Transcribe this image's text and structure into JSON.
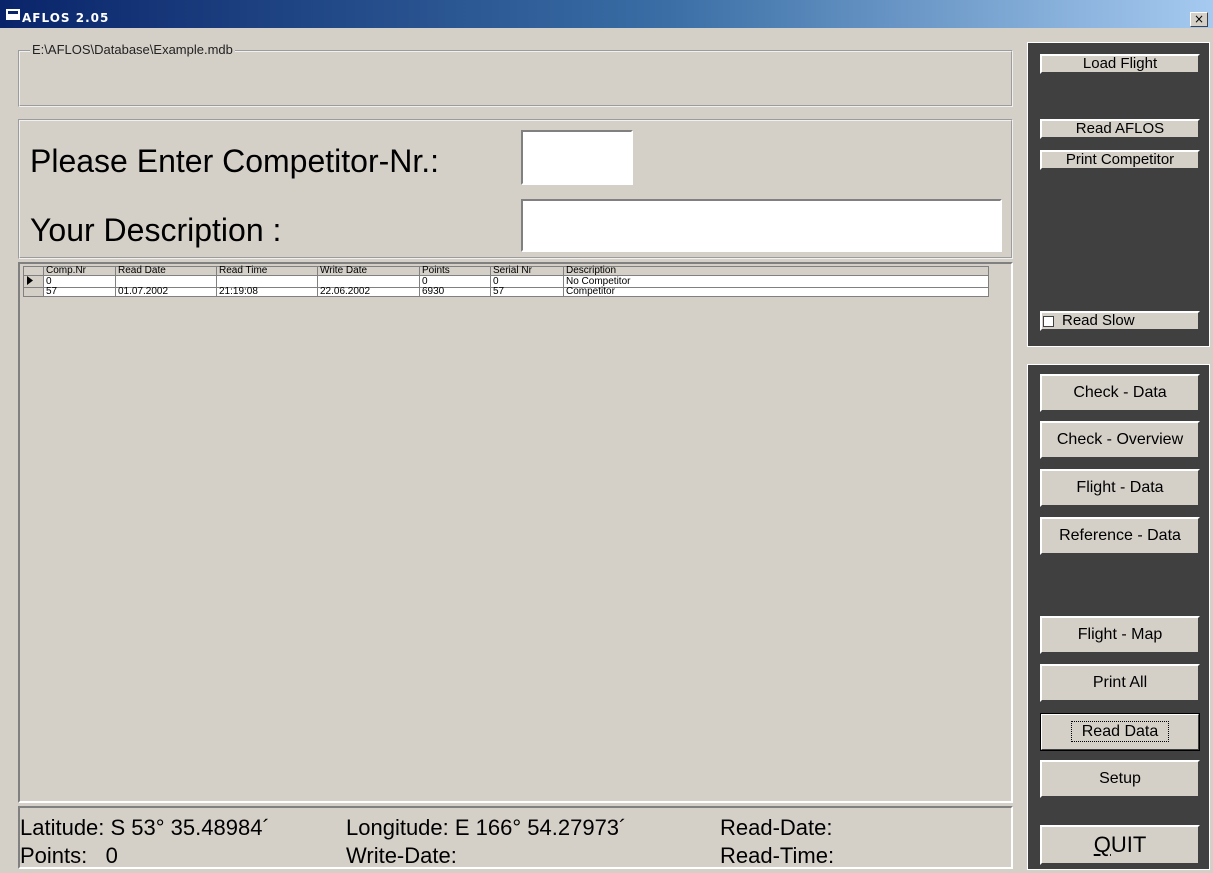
{
  "window": {
    "title": "AFLOS 2.05",
    "close_label": "×"
  },
  "database_path": "E:\\AFLOS\\Database\\Example.mdb",
  "entry": {
    "competitor_label": "Please Enter Competitor-Nr.:",
    "competitor_value": "",
    "description_label": "Your Description :",
    "description_value": ""
  },
  "grid": {
    "columns": [
      "Comp.Nr",
      "Read Date",
      "Read Time",
      "Write Date",
      "Points",
      "Serial Nr",
      "Description"
    ],
    "rows": [
      {
        "current": true,
        "cells": [
          "0",
          "",
          "",
          "",
          "0",
          "0",
          "No Competitor"
        ]
      },
      {
        "current": false,
        "cells": [
          "57",
          "01.07.2002",
          "21:19:08",
          "22.06.2002",
          "6930",
          "57",
          "Competitor"
        ]
      }
    ]
  },
  "status": {
    "latitude": "Latitude: S 53° 35.48984´",
    "longitude": "Longitude: E 166° 54.27973´",
    "read_date": "Read-Date:",
    "points": "Points:   0",
    "write_date": "Write-Date:",
    "read_time": "Read-Time:"
  },
  "buttons": {
    "load_flight": "Load Flight",
    "read_aflos": "Read AFLOS",
    "print_competitor": "Print Competitor",
    "read_slow": "Read Slow",
    "check_data": "Check - Data",
    "check_overview": "Check - Overview",
    "flight_data": "Flight - Data",
    "reference_data": "Reference - Data",
    "flight_map": "Flight - Map",
    "print_all": "Print All",
    "read_data": "Read Data",
    "setup": "Setup",
    "quit": "QUIT"
  },
  "read_slow_checked": false
}
